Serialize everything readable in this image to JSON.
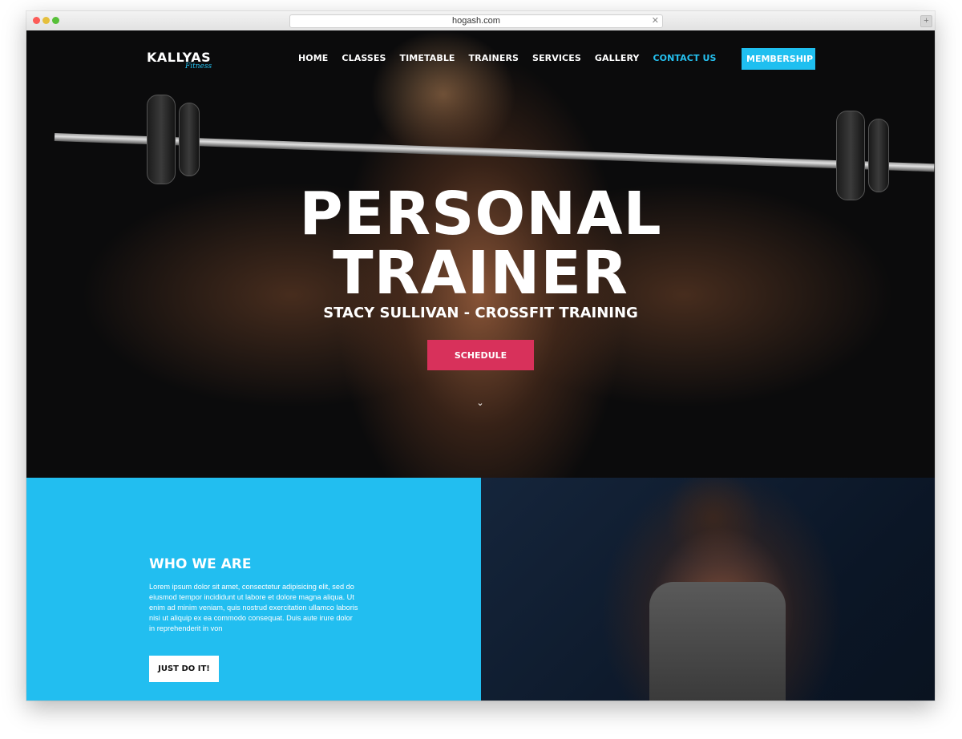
{
  "browser": {
    "url": "hogash.com",
    "close_glyph": "✕",
    "new_tab_glyph": "+"
  },
  "header": {
    "logo_main": "KALLYAS",
    "logo_sub": "Fitness",
    "nav": [
      {
        "label": "HOME"
      },
      {
        "label": "CLASSES"
      },
      {
        "label": "TIMETABLE"
      },
      {
        "label": "TRAINERS"
      },
      {
        "label": "SERVICES"
      },
      {
        "label": "GALLERY"
      },
      {
        "label": "CONTACT US"
      }
    ],
    "membership_label": "MEMBERSHIP"
  },
  "hero": {
    "title_line1": "PERSONAL",
    "title_line2": "TRAINER",
    "subtitle": "STACY SULLIVAN - CROSSFIT TRAINING",
    "schedule_label": "SCHEDULE",
    "scroll_glyph": "⌄"
  },
  "about": {
    "title": "WHO WE ARE",
    "text": "Lorem ipsum dolor sit amet, consectetur adipisicing elit, sed do eiusmod tempor incididunt ut labore et dolore magna aliqua. Ut enim ad minim veniam, quis nostrud exercitation ullamco laboris nisi ut aliquip ex ea commodo consequat. Duis aute irure dolor in reprehenderit in von",
    "button_label": "JUST DO IT!"
  },
  "colors": {
    "accent": "#22bef0",
    "schedule": "#d8315b"
  }
}
